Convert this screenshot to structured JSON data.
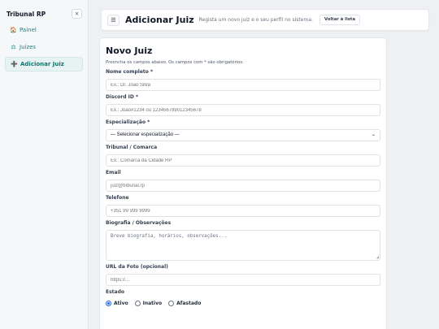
{
  "sidebar": {
    "title": "Tribunal RP",
    "close_glyph": "×",
    "items": [
      {
        "icon": "🏠",
        "label": "Painel"
      },
      {
        "icon": "⚖",
        "label": "Juízes"
      },
      {
        "icon": "➕",
        "label": "Adicionar Juiz"
      }
    ]
  },
  "topbar": {
    "menu_glyph": "☰",
    "title": "Adicionar Juiz",
    "subtitle": "Regista um novo juiz e o seu perfil no sistema.",
    "back_label": "Voltar à lista"
  },
  "form": {
    "title": "Novo Juiz",
    "description": "Preencha os campos abaixo. Os campos com * são obrigatórios.",
    "name": {
      "label": "Nome completo *",
      "placeholder": "Ex.: Dr. João Silva"
    },
    "discord": {
      "label": "Discord ID *",
      "placeholder": "Ex.: João#1234 ou 123456789012345678"
    },
    "specialization": {
      "label": "Especialização *",
      "value": "— Selecionar especialização —"
    },
    "court": {
      "label": "Tribunal / Comarca",
      "placeholder": "Ex.: Comarca da Cidade RP"
    },
    "email": {
      "label": "Email",
      "placeholder": "juiz@tribunal.rp"
    },
    "phone": {
      "label": "Telefone",
      "placeholder": "+351 99 999 9999"
    },
    "bio": {
      "label": "Biografia / Observações",
      "placeholder": "Breve biografia, horários, observações..."
    },
    "photo": {
      "label": "URL da Foto (opcional)",
      "placeholder": "https://..."
    },
    "status": {
      "label": "Estado",
      "options": [
        "Ativo",
        "Inativo",
        "Afastado"
      ],
      "selected": "Ativo"
    }
  },
  "colors": {
    "accent": "#0f766e",
    "radio_selected": "#2563eb"
  }
}
